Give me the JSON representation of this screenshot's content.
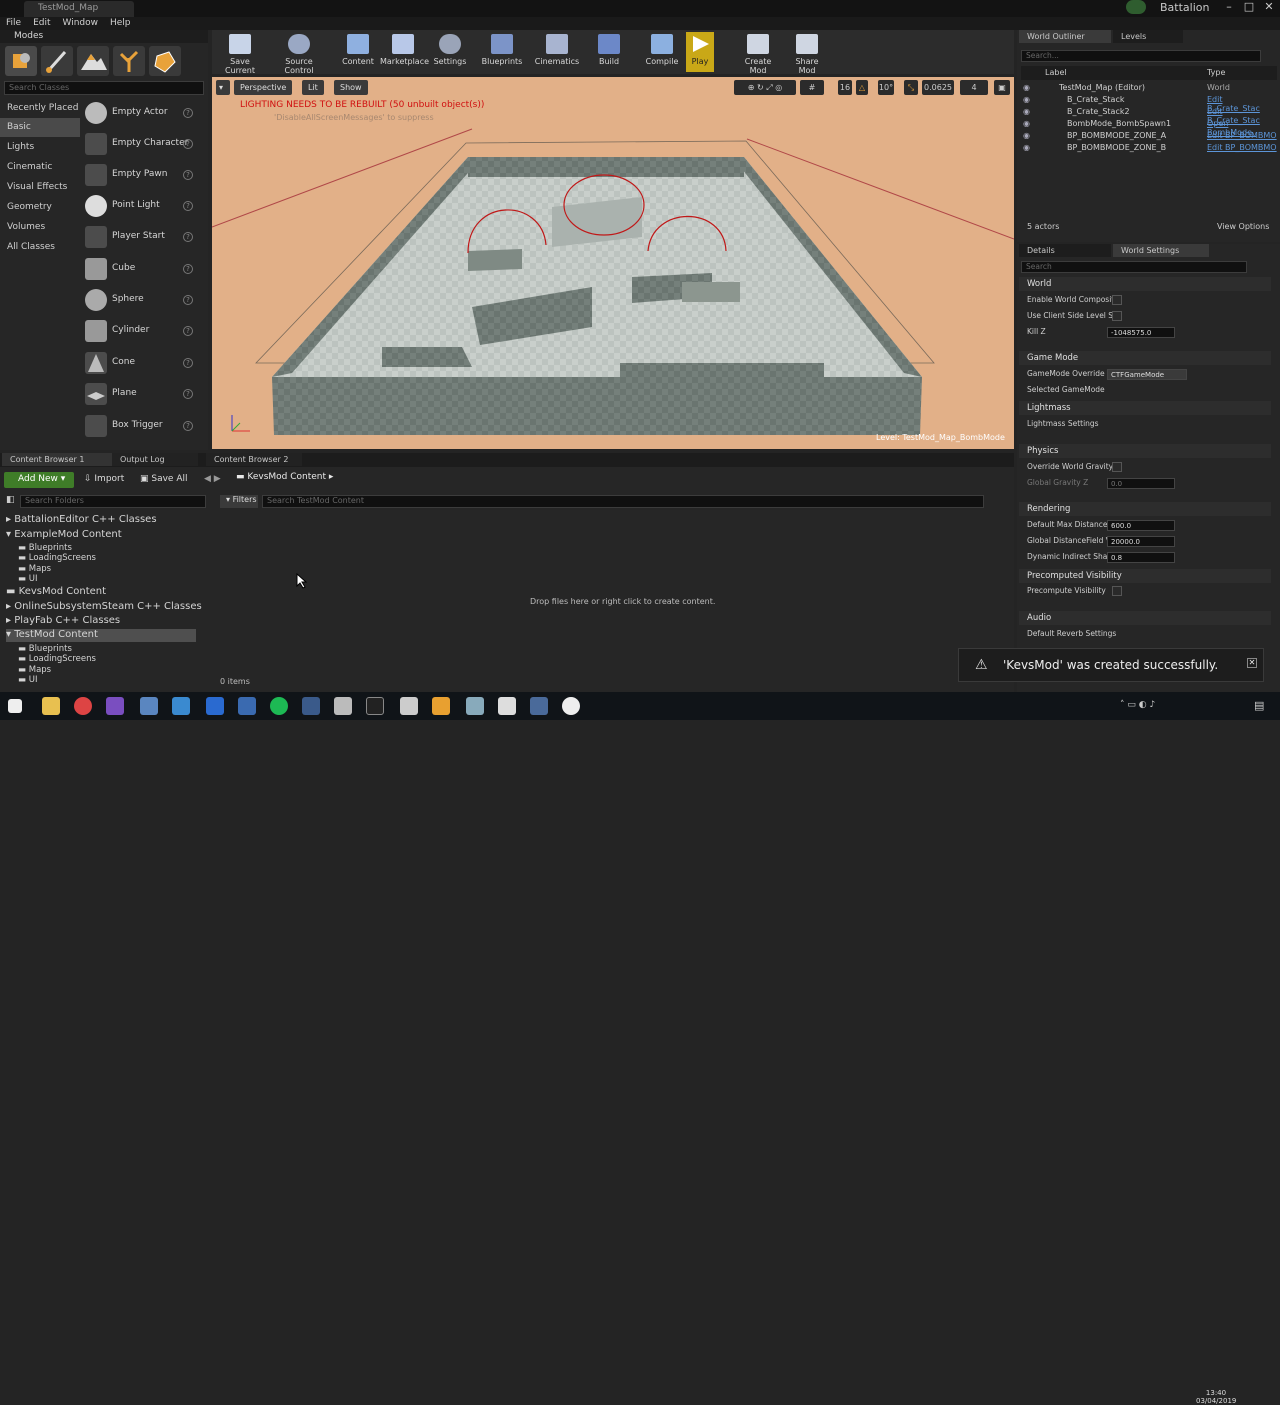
{
  "window": {
    "tab_title": "TestMod_Map",
    "project_name": "Battalion"
  },
  "menu": [
    "File",
    "Edit",
    "Window",
    "Help"
  ],
  "modes": {
    "header": "Modes",
    "search_placeholder": "Search Classes",
    "categories": [
      "Recently Placed",
      "Basic",
      "Lights",
      "Cinematic",
      "Visual Effects",
      "Geometry",
      "Volumes",
      "All Classes"
    ],
    "items": [
      "Empty Actor",
      "Empty Character",
      "Empty Pawn",
      "Point Light",
      "Player Start",
      "Cube",
      "Sphere",
      "Cylinder",
      "Cone",
      "Plane",
      "Box Trigger"
    ]
  },
  "toolbar": {
    "buttons": [
      "Save Current",
      "Source Control",
      "Content",
      "Marketplace",
      "Settings",
      "Blueprints",
      "Cinematics",
      "Build",
      "Compile",
      "Play",
      "Create Mod",
      "Share Mod"
    ]
  },
  "viewport": {
    "perspective_label": "Perspective",
    "lit_label": "Lit",
    "show_label": "Show",
    "warning": "LIGHTING NEEDS TO BE REBUILT (50 unbuilt object(s))",
    "suppress_hint": "'DisableAllScreenMessages' to suppress",
    "level_label": "Level:  TestMod_Map_BombMode",
    "snap_grid": "16",
    "snap_rotation": "10°",
    "snap_scale": "0.0625",
    "camera_speed": "4"
  },
  "outliner": {
    "tabs": [
      "World Outliner",
      "Levels"
    ],
    "search_placeholder": "Search...",
    "col_label": "Label",
    "col_type": "Type",
    "rows": [
      {
        "label": "TestMod_Map (Editor)",
        "type": "World"
      },
      {
        "label": "B_Crate_Stack",
        "type": "Edit B_Crate_Stac"
      },
      {
        "label": "B_Crate_Stack2",
        "type": "Edit B_Crate_Stac"
      },
      {
        "label": "BombMode_BombSpawn1",
        "type": "Open BombMode_"
      },
      {
        "label": "BP_BOMBMODE_ZONE_A",
        "type": "Edit BP_BOMBMO"
      },
      {
        "label": "BP_BOMBMODE_ZONE_B",
        "type": "Edit BP_BOMBMO"
      }
    ],
    "actor_count": "5 actors",
    "view_options": "View Options"
  },
  "details": {
    "tabs": [
      "Details",
      "World Settings"
    ],
    "search_placeholder": "Search",
    "sections": {
      "world": "World",
      "gamemode": "Game Mode",
      "lightmass": "Lightmass",
      "physics": "Physics",
      "rendering": "Rendering",
      "precomputed": "Precomputed Visibility",
      "audio": "Audio"
    },
    "props": {
      "enable_world_composition": "Enable World Composit",
      "use_client_side_level": "Use Client Side Level S",
      "kill_z": "Kill Z",
      "kill_z_value": "-1048575.0",
      "gamemode_override": "GameMode Override",
      "gamemode_override_value": "CTFGameMode",
      "selected_gamemode": "Selected GameMode",
      "lightmass_settings": "Lightmass Settings",
      "override_world_gravity": "Override World Gravity",
      "global_gravity_z": "Global Gravity Z",
      "global_gravity_z_value": "0.0",
      "default_max_distance": "Default Max DistanceF",
      "default_max_distance_value": "600.0",
      "global_distance_field": "Global DistanceField Vi",
      "global_distance_field_value": "20000.0",
      "dynamic_indirect_shadow": "Dynamic Indirect Shad",
      "dynamic_indirect_shadow_value": "0.8",
      "precompute_visibility": "Precompute Visibility",
      "default_reverb": "Default Reverb Settings"
    }
  },
  "content_browser": {
    "tabs": [
      "Content Browser 1",
      "Output Log",
      "Content Browser 2"
    ],
    "add_new": "Add New",
    "import": "Import",
    "save_all": "Save All",
    "breadcrumb": "KevsMod Content",
    "search_folders_placeholder": "Search Folders",
    "filters_label": "Filters",
    "search_content_placeholder": "Search TestMod Content",
    "folders": [
      {
        "name": "BattalionEditor C++ Classes",
        "indent": 0
      },
      {
        "name": "ExampleMod Content",
        "indent": 0
      },
      {
        "name": "Blueprints",
        "indent": 1
      },
      {
        "name": "LoadingScreens",
        "indent": 1
      },
      {
        "name": "Maps",
        "indent": 1
      },
      {
        "name": "UI",
        "indent": 1
      },
      {
        "name": "KevsMod Content",
        "indent": 0
      },
      {
        "name": "OnlineSubsystemSteam C++ Classes",
        "indent": 0
      },
      {
        "name": "PlayFab C++ Classes",
        "indent": 0
      },
      {
        "name": "TestMod Content",
        "indent": 0
      },
      {
        "name": "Blueprints",
        "indent": 1
      },
      {
        "name": "LoadingScreens",
        "indent": 1
      },
      {
        "name": "Maps",
        "indent": 1
      },
      {
        "name": "UI",
        "indent": 1
      }
    ],
    "drop_hint": "Drop files here or right click to create content.",
    "item_count": "0 items"
  },
  "toast": {
    "message": "'KevsMod' was created successfully."
  },
  "taskbar": {
    "time": "13:40",
    "date": "03/04/2019"
  }
}
